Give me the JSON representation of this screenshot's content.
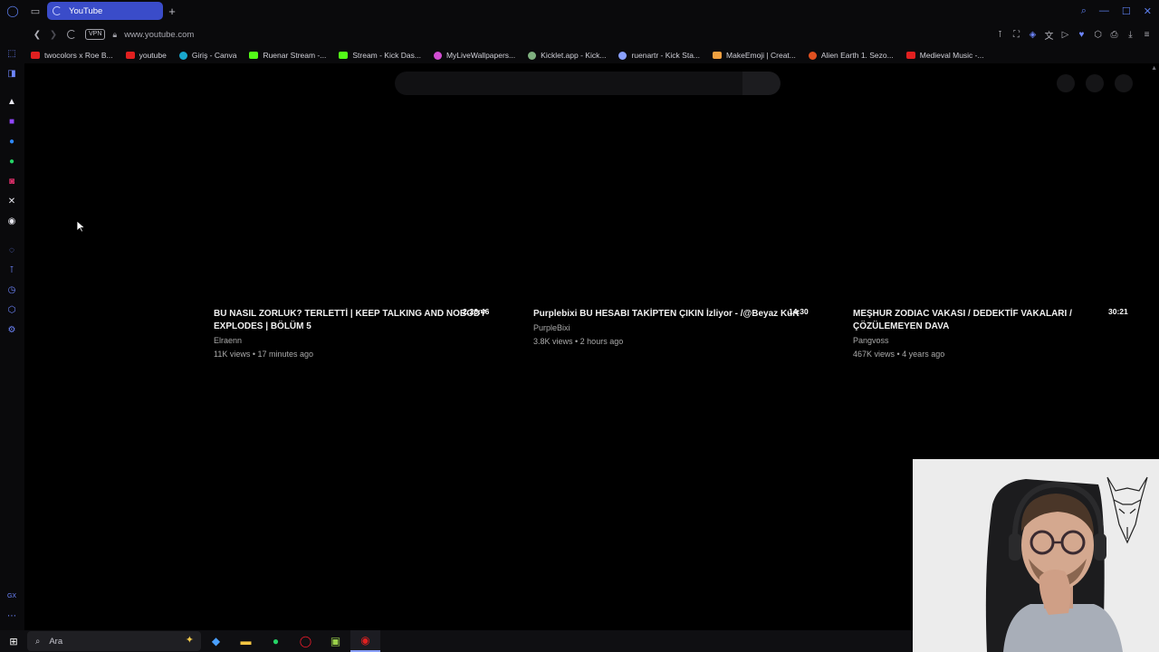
{
  "browser": {
    "tab": {
      "title": "YouTube"
    },
    "address": {
      "vpn_label": "VPN",
      "url": "www.youtube.com"
    },
    "bookmarks": [
      {
        "label": "twocolors x Roe B...",
        "color": "#e02020"
      },
      {
        "label": "youtube",
        "color": "#e02020"
      },
      {
        "label": "Giriş - Canva",
        "color": "#19a7ce"
      },
      {
        "label": "Ruenar Stream -...",
        "color": "#53fc18"
      },
      {
        "label": "Stream - Kick Das...",
        "color": "#53fc18"
      },
      {
        "label": "MyLiveWallpapers...",
        "color": "#d24dd2"
      },
      {
        "label": "Kicklet.app - Kick...",
        "color": "#7fb07f"
      },
      {
        "label": "ruenartr - Kick Sta...",
        "color": "#8aa0ff"
      },
      {
        "label": "MakeEmoji | Creat...",
        "color": "#f0a040"
      },
      {
        "label": "Alien Earth 1. Sezo...",
        "color": "#e05020"
      },
      {
        "label": "Medieval Music -...",
        "color": "#e02020"
      }
    ]
  },
  "videos": [
    {
      "duration": "2:26:46",
      "title": "BU NASIL ZORLUK? TERLETTİ | KEEP TALKING AND NOBODY EXPLODES | BÖLÜM 5",
      "channel": "Elraenn",
      "meta": "11K views • 17 minutes ago"
    },
    {
      "duration": "14:30",
      "title": "Purplebixi BU HESABI TAKİPTEN ÇIKIN İzliyor - /@Beyaz Kurt",
      "channel": "PurpleBixi",
      "meta": "3.8K views • 2 hours ago"
    },
    {
      "duration": "30:21",
      "title": "MEŞHUR ZODIAC VAKASI / DEDEKTİF VAKALARI / ÇÖZÜLEMEYEN DAVA",
      "channel": "Pangvoss",
      "meta": "467K views • 4 years ago"
    }
  ],
  "taskbar": {
    "search_placeholder": "Ara"
  },
  "colors": {
    "accent": "#3a4cc9",
    "sidebar_icon": "#6e86ff",
    "background": "#000000"
  }
}
